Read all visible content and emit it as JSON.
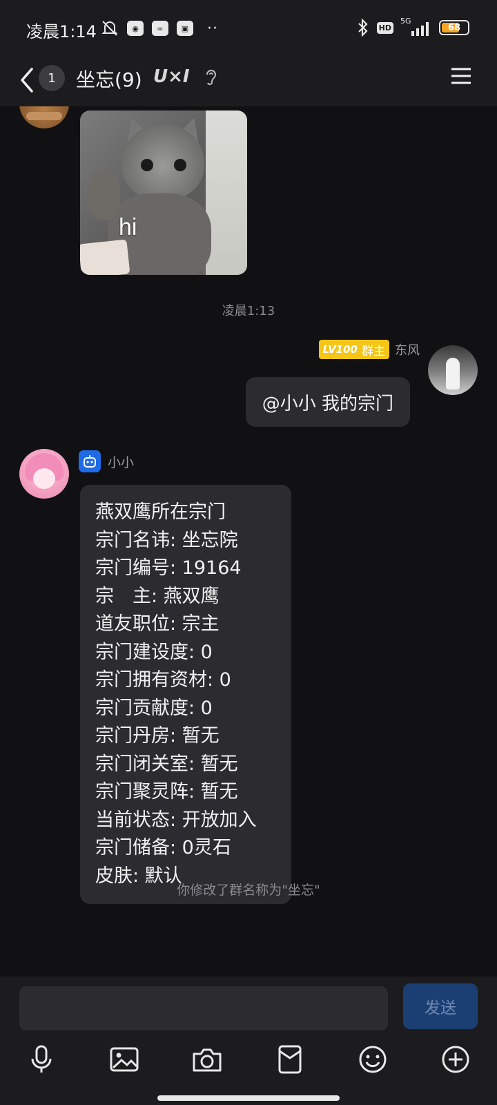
{
  "status_bar": {
    "time": "凌晨1:14",
    "network": "5G",
    "hd": "HD",
    "battery": "68"
  },
  "header": {
    "unread_count": "1",
    "title": "坐忘(9)",
    "brand": "U×I"
  },
  "messages": {
    "image_caption": "hi",
    "timestamp": "凌晨1:13",
    "me": {
      "level": "LV100",
      "role": "群主",
      "name": "东风",
      "text": "@小小 我的宗门"
    },
    "bot": {
      "name": "小小",
      "lines": [
        "燕双鹰所在宗门",
        "宗门名讳: 坐忘院",
        "宗门编号: 19164",
        "宗　主: 燕双鹰",
        "道友职位: 宗主",
        "宗门建设度: 0",
        "宗门拥有资材: 0",
        "宗门贡献度: 0",
        "宗门丹房: 暂无",
        "宗门闭关室: 暂无",
        "宗门聚灵阵: 暂无",
        "当前状态: 开放加入",
        "宗门储备: 0灵石",
        "皮肤: 默认"
      ]
    },
    "system_notice": "你修改了群名称为\"坐忘\""
  },
  "input": {
    "value": "",
    "send_label": "发送"
  },
  "toolbar": {
    "icons": [
      "microphone-icon",
      "image-icon",
      "camera-icon",
      "red-packet-icon",
      "emoji-icon",
      "plus-icon"
    ]
  },
  "colors": {
    "background": "#111113",
    "bar": "#1c1c1f",
    "bubble": "#2b2b30",
    "owner_badge": "#f5c518",
    "bot_badge": "#1f6ae6",
    "send_button": "#1b3f73"
  }
}
